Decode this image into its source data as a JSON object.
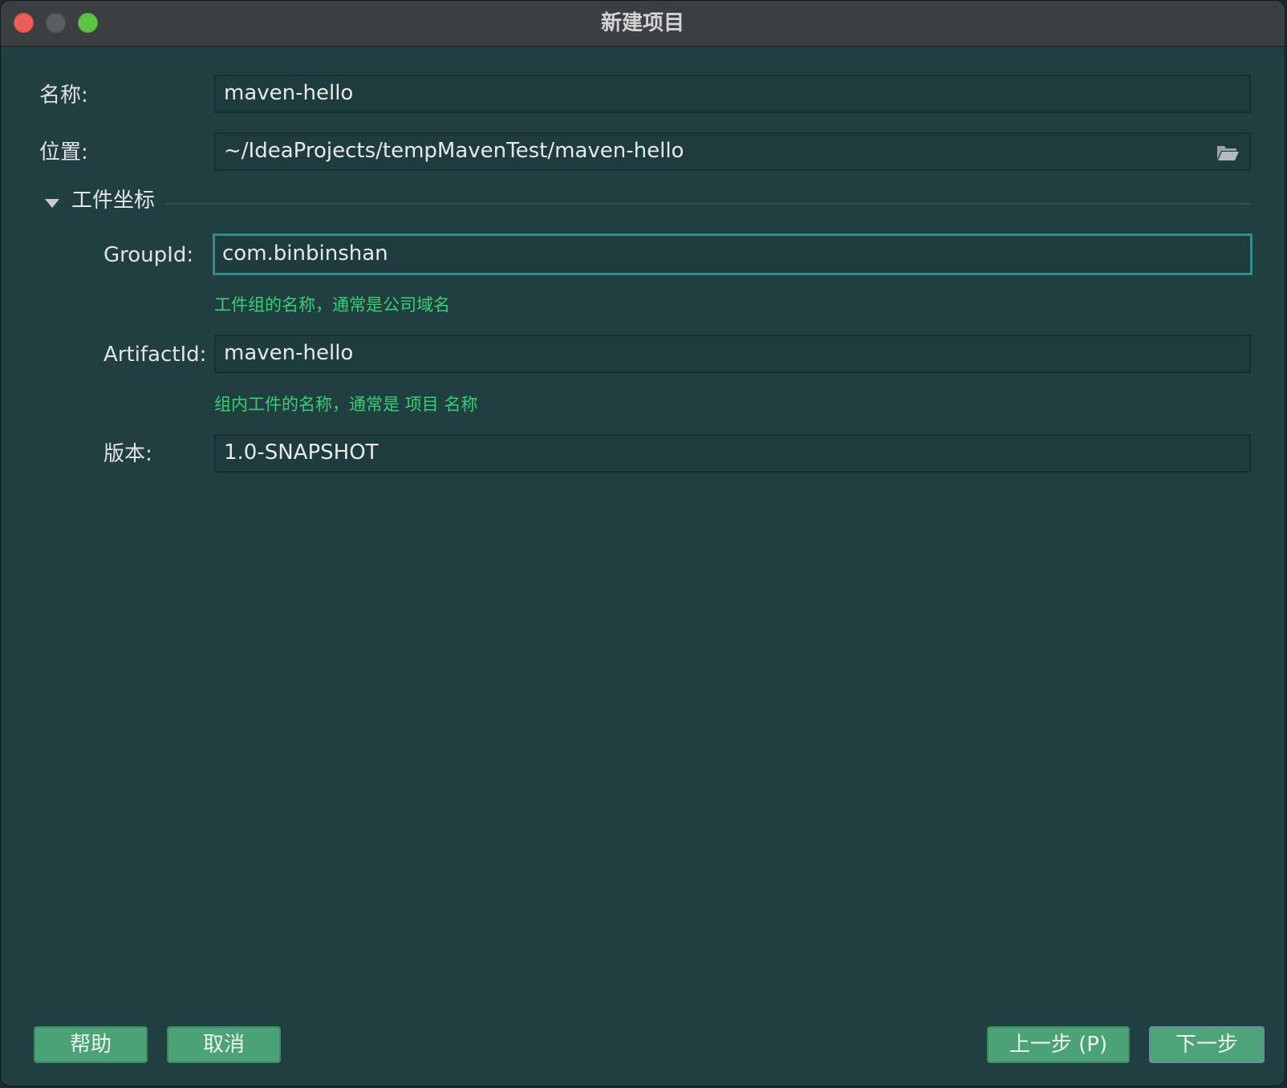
{
  "window": {
    "title": "新建项目"
  },
  "form": {
    "name_label": "名称:",
    "name_value": "maven-hello",
    "location_label": "位置:",
    "location_value": "~/IdeaProjects/tempMavenTest/maven-hello",
    "section_title": "工件坐标",
    "group_label": "GroupId:",
    "group_value": "com.binbinshan",
    "group_hint": "工件组的名称，通常是公司域名",
    "artifact_label": "ArtifactId:",
    "artifact_value": "maven-hello",
    "artifact_hint": "组内工件的名称，通常是 项目 名称",
    "version_label": "版本:",
    "version_value": "1.0-SNAPSHOT"
  },
  "buttons": {
    "help": "帮助",
    "cancel": "取消",
    "previous": "上一步 (P)",
    "next": "下一步"
  },
  "icons": {
    "folder": "folder-icon",
    "collapse": "triangle-down-icon"
  }
}
